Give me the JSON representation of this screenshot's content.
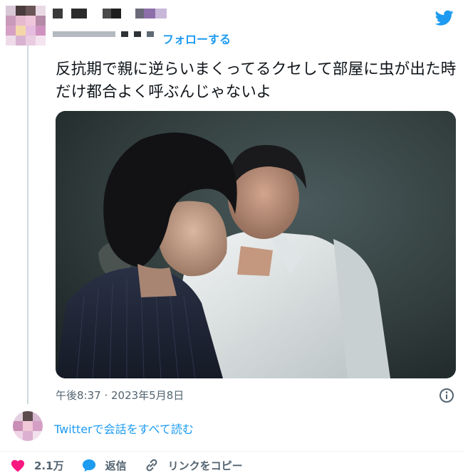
{
  "header": {
    "follow_label": "フォローする",
    "brand_icon": "twitter-bird-icon",
    "brand_color": "#1d9bf0"
  },
  "tweet": {
    "text": "反抗期で親に逆らいまくってるクセして部屋に虫が出た時だけ都合よく呼ぶんじゃないよ",
    "timestamp": "午後8:37 · 2023年5月8日",
    "read_all_label": "Twitterで会話をすべて読む"
  },
  "actions": {
    "like_icon": "heart-icon",
    "like_count": "2.1万",
    "like_color": "#f91880",
    "reply_icon": "speech-bubble-icon",
    "reply_label": "返信",
    "link_icon": "link-icon",
    "link_label": "リンクをコピー"
  }
}
